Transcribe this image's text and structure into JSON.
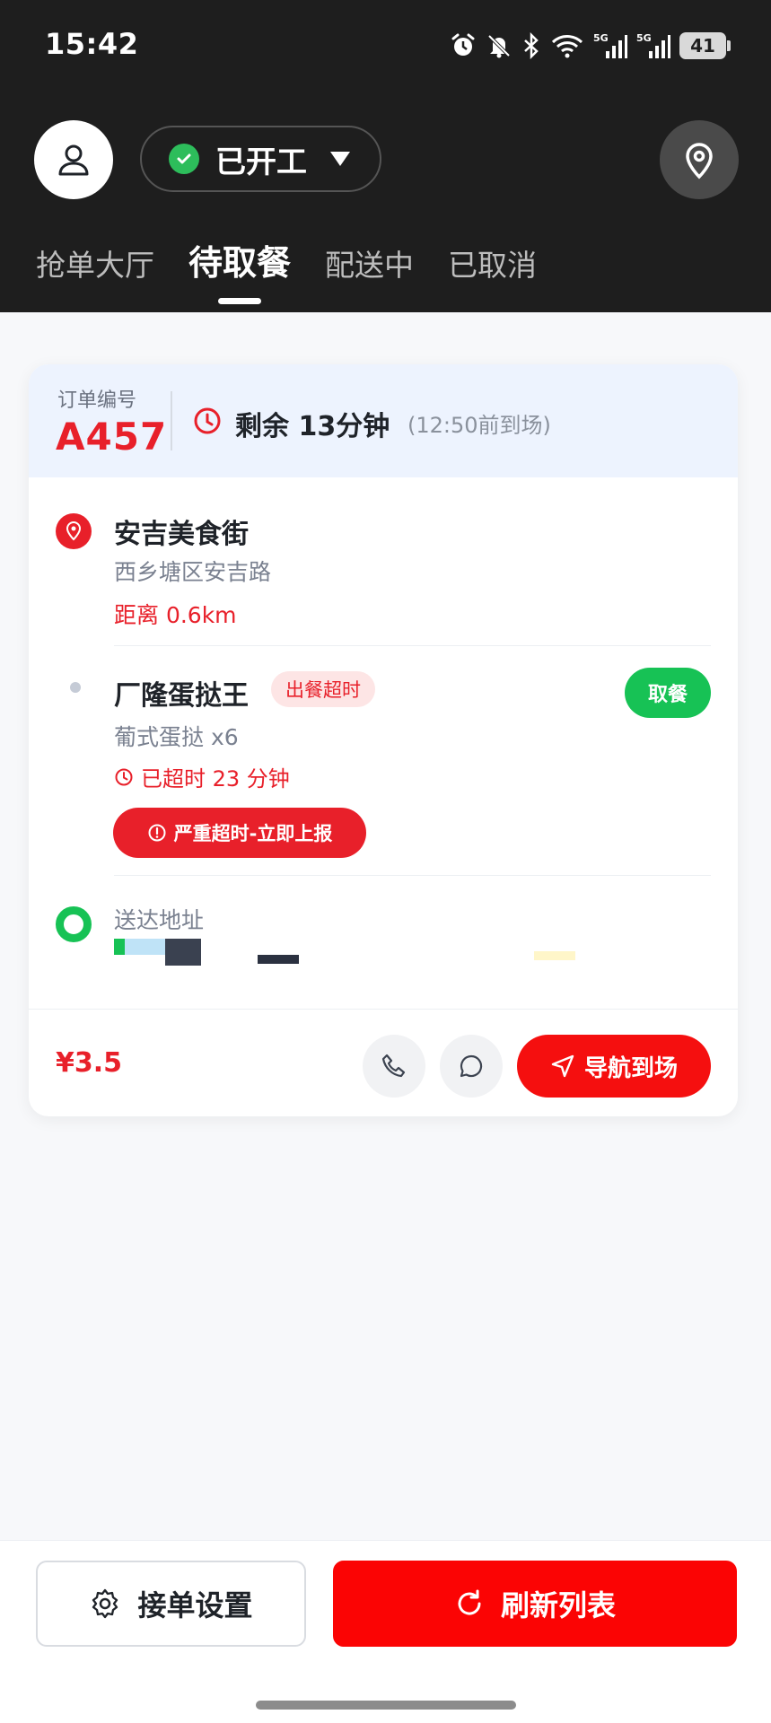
{
  "status_bar": {
    "time": "15:42",
    "battery": "41",
    "icons": [
      "alarm-icon",
      "mute-icon",
      "bluetooth-icon",
      "wifi-icon",
      "signal-5g-icon",
      "signal-5g-icon",
      "battery-icon"
    ]
  },
  "header": {
    "work_status": "已开工",
    "tabs": [
      {
        "label": "抢单大厅",
        "active": false
      },
      {
        "label": "待取餐",
        "active": true
      },
      {
        "label": "配送中",
        "active": false
      },
      {
        "label": "已取消",
        "active": false
      }
    ]
  },
  "order": {
    "number_label": "订单编号",
    "number": "A457",
    "remaining": "剩余 13分钟",
    "arrive_by": "(12:50前到场)",
    "shop": {
      "name": "安吉美食街",
      "address": "西乡塘区安吉路",
      "distance": "距离 0.6km"
    },
    "item": {
      "name": "厂隆蛋挞王",
      "badge": "出餐超时",
      "pickup_label": "取餐",
      "detail": "葡式蛋挞 x6",
      "overdue": "已超时 23 分钟",
      "report_label": "严重超时-立即上报"
    },
    "delivery": {
      "label": "送达地址"
    },
    "price": "¥3.5",
    "navigate_label": "导航到场"
  },
  "footer": {
    "settings_label": "接单设置",
    "refresh_label": "刷新列表"
  },
  "colors": {
    "accent": "#e8202a",
    "pickup_green": "#17c255",
    "header_bg": "#1e1e1e",
    "card_head_bg": "#edf3fe"
  }
}
